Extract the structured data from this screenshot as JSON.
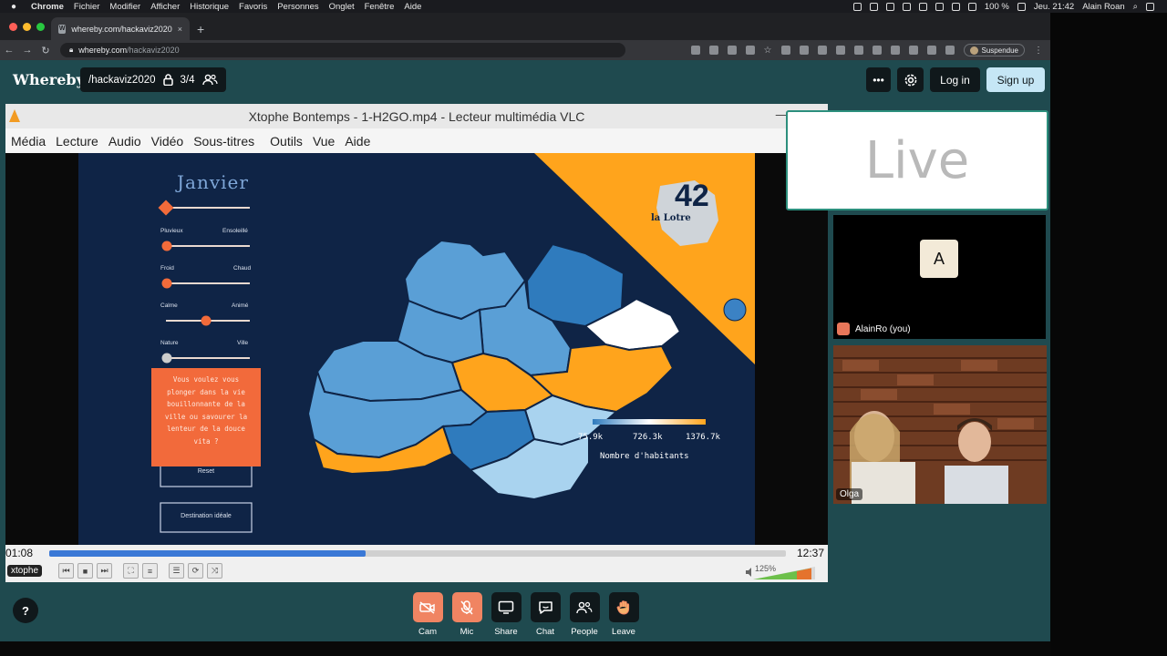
{
  "menubar": {
    "app": "Chrome",
    "items": [
      "Fichier",
      "Modifier",
      "Afficher",
      "Historique",
      "Favoris",
      "Personnes",
      "Onglet",
      "Fenêtre",
      "Aide"
    ],
    "battery": "100 %",
    "clock": "Jeu. 21:42",
    "user": "Alain Roan"
  },
  "browser": {
    "tab_title": "whereby.com/hackaviz2020",
    "url_host": "whereby.com",
    "url_path": "/hackaviz2020",
    "profile_label": "Suspendue"
  },
  "whereby": {
    "logo": "Whereby",
    "room": "/hackaviz2020",
    "participants": "3/4",
    "login": "Log in",
    "signup": "Sign up",
    "more": "•••",
    "help": "?"
  },
  "vlc": {
    "title": "Xtophe Bontemps - 1-H2GO.mp4 - Lecteur multimédia VLC",
    "menu": [
      "Média",
      "Lecture",
      "Audio",
      "Vidéo",
      "Sous-titres",
      "Outils",
      "Vue",
      "Aide"
    ],
    "elapsed": "01:08",
    "total": "12:37",
    "progress": 0.43,
    "volume": "125%",
    "name_tag": "xtophe"
  },
  "slide": {
    "month": "Janvier",
    "sliders": [
      {
        "left": "Pluvieux",
        "right": "Ensoleillé",
        "value": 0.02
      },
      {
        "left": "Froid",
        "right": "Chaud",
        "value": 0.02
      },
      {
        "left": "Calme",
        "right": "Animé",
        "value": 0.5
      },
      {
        "left": "Nature",
        "right": "Ville",
        "value": 0.02
      }
    ],
    "tooltip": "Vous voulez vous plonger dans la vie bouillonnante de la ville ou savourer la lenteur de la douce vita ?",
    "reset": "Reset",
    "ideal": "Destination idéale",
    "legend_min": "75.9k",
    "legend_mid": "726.3k",
    "legend_max": "1376.7k",
    "legend_title": "Nombre d'habitants",
    "badge_number": "42",
    "badge_sub": "la Lotre",
    "colors": {
      "orange": "#ffa41c",
      "navy": "#0f2446",
      "light": "#a9d3ef",
      "mid": "#5a9fd6",
      "dark": "#2f7bbd"
    }
  },
  "panel": {
    "live": "Live",
    "me_initial": "A",
    "me_name": "AlainRo (you)",
    "other_name": "Olga"
  },
  "toolbar": [
    {
      "label": "Cam",
      "icon": "camera-off-icon"
    },
    {
      "label": "Mic",
      "icon": "mic-off-icon"
    },
    {
      "label": "Share",
      "icon": "screen-share-icon"
    },
    {
      "label": "Chat",
      "icon": "chat-icon"
    },
    {
      "label": "People",
      "icon": "people-icon"
    },
    {
      "label": "Leave",
      "icon": "wave-hand-icon"
    }
  ]
}
